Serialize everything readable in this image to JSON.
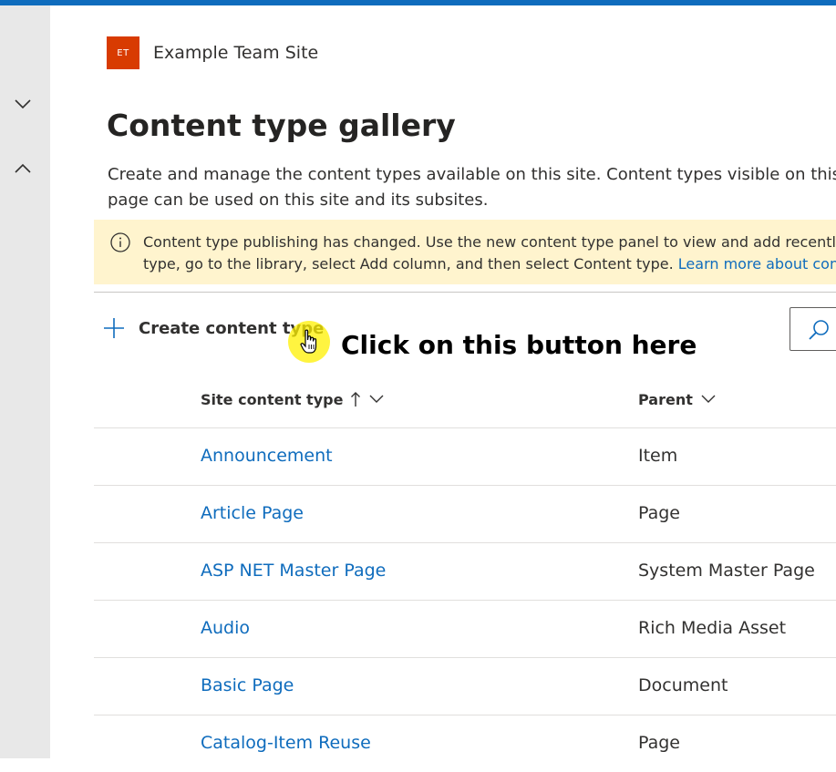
{
  "site": {
    "logo_text": "ET",
    "name": "Example Team Site"
  },
  "page": {
    "title": "Content type gallery",
    "description": "Create and manage the content types available on this site. Content types visible on this page can be used on this site and its subsites."
  },
  "notice": {
    "text_line1": "Content type publishing has changed. Use the new content type panel to view and add recently",
    "text_line2": "type, go to the library, select Add column, and then select Content type.",
    "link": "Learn more about content types"
  },
  "command_bar": {
    "create_label": "Create content type"
  },
  "annotation": {
    "text": "Click on this button here"
  },
  "table": {
    "columns": {
      "name": "Site content type",
      "parent": "Parent"
    },
    "rows": [
      {
        "name": "Announcement",
        "parent": "Item"
      },
      {
        "name": "Article Page",
        "parent": "Page"
      },
      {
        "name": "ASP NET Master Page",
        "parent": "System Master Page"
      },
      {
        "name": "Audio",
        "parent": "Rich Media Asset"
      },
      {
        "name": "Basic Page",
        "parent": "Document"
      },
      {
        "name": "Catalog-Item Reuse",
        "parent": "Page"
      }
    ]
  },
  "colors": {
    "accent": "#0f6cbd",
    "site_logo": "#d83b01",
    "notice_bg": "#fff4ce",
    "highlight": "#fff000"
  },
  "icons": {
    "rail_expand": "chevron-down-icon",
    "rail_collapse": "chevron-up-icon",
    "notice": "info-icon",
    "create": "plus-icon",
    "search": "search-icon",
    "sort": "arrow-up-icon",
    "column_menu": "chevron-down-icon"
  }
}
